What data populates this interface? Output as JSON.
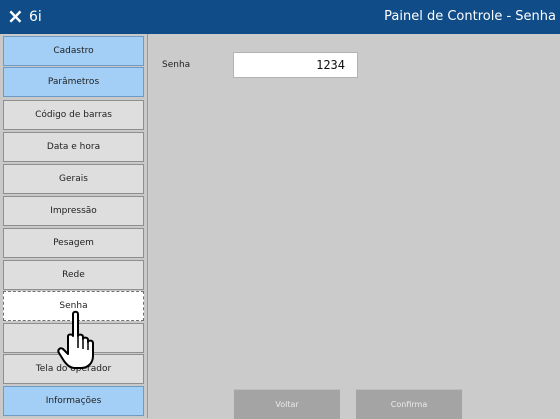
{
  "titlebar": {
    "close_icon": "×",
    "app_name": "6i",
    "window_title": "Painel de Controle - Senha",
    "color": "#0f4c88"
  },
  "sidebar": {
    "items": [
      {
        "label": "Cadastro",
        "style": "blue"
      },
      {
        "label": "Parâmetros",
        "style": "blue"
      },
      {
        "label": "Código de barras",
        "style": "gray"
      },
      {
        "label": "Data e hora",
        "style": "gray"
      },
      {
        "label": "Gerais",
        "style": "gray"
      },
      {
        "label": "Impressão",
        "style": "gray"
      },
      {
        "label": "Pesagem",
        "style": "gray"
      },
      {
        "label": "Rede",
        "style": "gray"
      },
      {
        "label": "Senha",
        "style": "active"
      },
      {
        "label": "",
        "style": "gray"
      },
      {
        "label": "Tela do operador",
        "style": "gray"
      },
      {
        "label": "Informações",
        "style": "blue"
      }
    ]
  },
  "form": {
    "password_label": "Senha",
    "password_value": "1234"
  },
  "buttons": {
    "back_label": "Voltar",
    "confirm_label": "Confirma"
  },
  "cursor": {
    "icon": "hand-pointer-icon"
  }
}
